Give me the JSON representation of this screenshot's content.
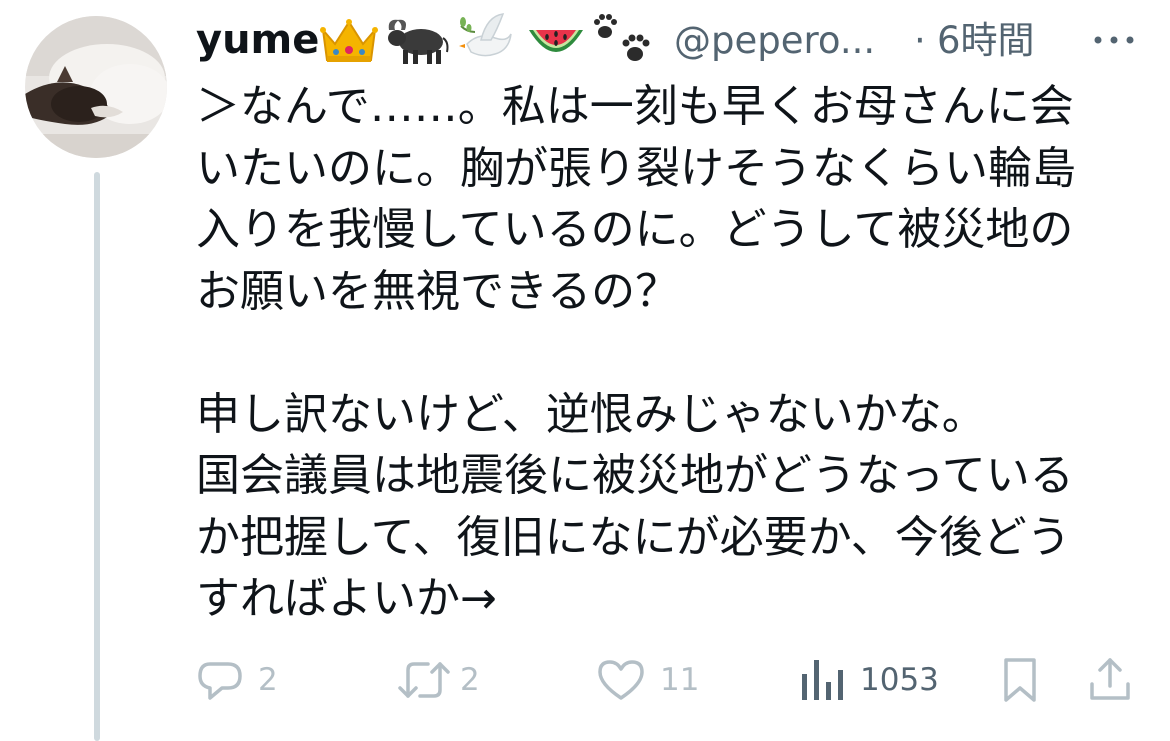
{
  "tweet": {
    "author": {
      "display_name": "yume",
      "name_emojis": [
        "crown-emoji",
        "water-buffalo-emoji",
        "dove-emoji",
        "watermelon-emoji",
        "paw-prints-emoji"
      ],
      "handle": "@pepero...",
      "separator": "·",
      "time": "6時間"
    },
    "body_lines": [
      "＞なんで……。私は一刻も早くお母さんに会",
      "いたいのに。胸が張り裂けそうなくらい輪島",
      "入りを我慢しているのに。どうして被災地の",
      "お願いを無視できるの？",
      "",
      "申し訳ないけど、逆恨みじゃないかな。",
      "国会議員は地震後に被災地がどうなっている",
      "か把握して、復旧になにが必要か、今後どう",
      "すればよいか→"
    ],
    "actions": {
      "reply_count": "2",
      "retweet_count": "2",
      "like_count": "11",
      "views_count": "1053"
    }
  },
  "colors": {
    "text_primary": "#0f1419",
    "text_secondary": "#536471",
    "action_muted": "#b4bfc6",
    "thread_line": "#cfd9de"
  }
}
